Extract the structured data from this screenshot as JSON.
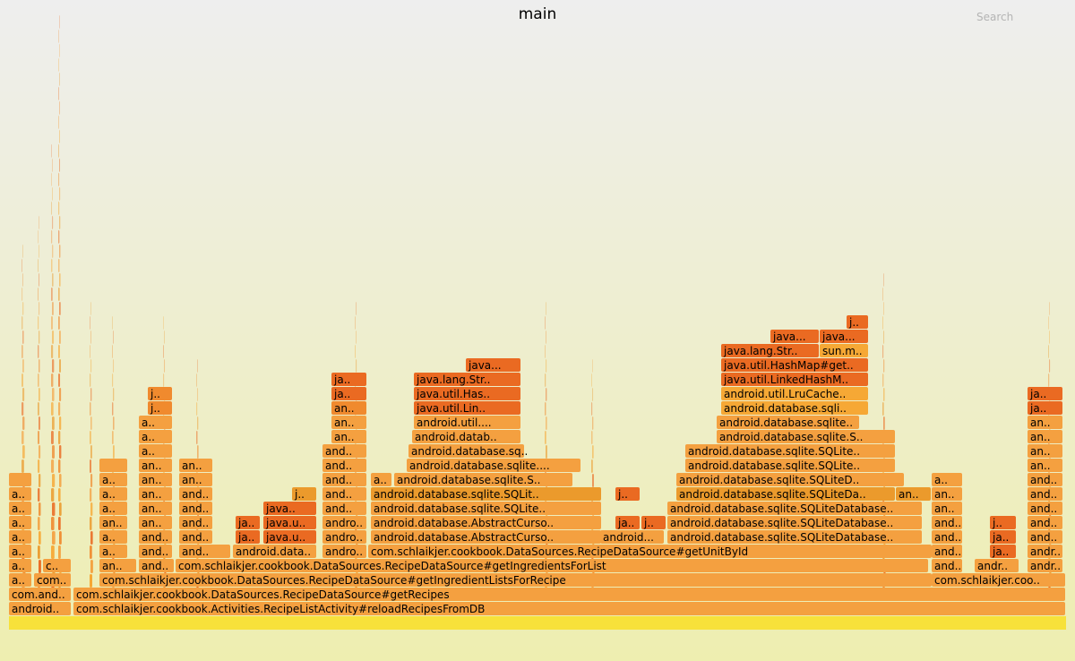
{
  "header": {
    "title": "main",
    "search_label": "Search"
  },
  "chart_data": {
    "type": "flame",
    "unit": "samples",
    "total": 1180,
    "root_color": "#f7e13a",
    "frame_colors": [
      "#f4a040",
      "#f08a2e",
      "#ea6a22",
      "#eb9a2c",
      "#f6a835"
    ],
    "frames": [
      {
        "d": 1,
        "s": 0,
        "w": 70,
        "label": "android..",
        "c": 0
      },
      {
        "d": 1,
        "s": 72,
        "w": 1108,
        "label": "com.schlaikjer.cookbook.Activities.RecipeListActivity#reloadRecipesFromDB",
        "c": 0
      },
      {
        "d": 2,
        "s": 0,
        "w": 70,
        "label": "com.and..",
        "c": 0
      },
      {
        "d": 2,
        "s": 72,
        "w": 1108,
        "label": "com.schlaikjer.cookbook.DataSources.RecipeDataSource#getRecipes",
        "c": 0
      },
      {
        "d": 3,
        "s": 0,
        "w": 26,
        "label": "a..",
        "c": 0
      },
      {
        "d": 3,
        "s": 28,
        "w": 42,
        "label": "com..",
        "c": 0
      },
      {
        "d": 3,
        "s": 101,
        "w": 930,
        "label": "com.schlaikjer.cookbook.DataSources.RecipeDataSource#getIngredientListsForRecipe",
        "c": 0
      },
      {
        "d": 3,
        "s": 1030,
        "w": 150,
        "label": "com.schlaikjer.coo..",
        "c": 0
      },
      {
        "d": 4,
        "s": 0,
        "w": 26,
        "label": "a..",
        "c": 0
      },
      {
        "d": 4,
        "s": 38,
        "w": 32,
        "label": "c..",
        "c": 0
      },
      {
        "d": 4,
        "s": 101,
        "w": 42,
        "label": "an..",
        "c": 0
      },
      {
        "d": 4,
        "s": 145,
        "w": 40,
        "label": "and..",
        "c": 0
      },
      {
        "d": 4,
        "s": 186,
        "w": 841,
        "label": "com.schlaikjer.cookbook.DataSources.RecipeDataSource#getIngredientsForList",
        "c": 0
      },
      {
        "d": 4,
        "s": 1030,
        "w": 35,
        "label": "and..",
        "c": 0
      },
      {
        "d": 4,
        "s": 1078,
        "w": 50,
        "label": "andr..",
        "c": 0
      },
      {
        "d": 4,
        "s": 1137,
        "w": 40,
        "label": "andr..",
        "c": 0
      },
      {
        "d": 5,
        "s": 0,
        "w": 26,
        "label": "a..",
        "c": 0
      },
      {
        "d": 5,
        "s": 101,
        "w": 32,
        "label": "a..",
        "c": 0
      },
      {
        "d": 5,
        "s": 145,
        "w": 38,
        "label": "and..",
        "c": 0
      },
      {
        "d": 5,
        "s": 190,
        "w": 58,
        "label": "and..",
        "c": 0
      },
      {
        "d": 5,
        "s": 250,
        "w": 94,
        "label": "android.data..",
        "c": 0
      },
      {
        "d": 5,
        "s": 350,
        "w": 50,
        "label": "andro..",
        "c": 0
      },
      {
        "d": 5,
        "s": 401,
        "w": 630,
        "label": "com.schlaikjer.cookbook.DataSources.RecipeDataSource#getUnitById",
        "c": 0
      },
      {
        "d": 5,
        "s": 1030,
        "w": 35,
        "label": "and..",
        "c": 0
      },
      {
        "d": 5,
        "s": 1095,
        "w": 30,
        "label": "ja..",
        "c": 2
      },
      {
        "d": 5,
        "s": 1137,
        "w": 40,
        "label": "andr..",
        "c": 0
      },
      {
        "d": 6,
        "s": 0,
        "w": 26,
        "label": "a..",
        "c": 0
      },
      {
        "d": 6,
        "s": 101,
        "w": 32,
        "label": "a..",
        "c": 0
      },
      {
        "d": 6,
        "s": 145,
        "w": 38,
        "label": "and..",
        "c": 0
      },
      {
        "d": 6,
        "s": 190,
        "w": 38,
        "label": "and..",
        "c": 0
      },
      {
        "d": 6,
        "s": 253,
        "w": 28,
        "label": "ja..",
        "c": 2
      },
      {
        "d": 6,
        "s": 284,
        "w": 60,
        "label": "java.u..",
        "c": 2
      },
      {
        "d": 6,
        "s": 350,
        "w": 50,
        "label": "andro..",
        "c": 0
      },
      {
        "d": 6,
        "s": 404,
        "w": 258,
        "label": "android.database.AbstractCurso..",
        "c": 0
      },
      {
        "d": 6,
        "s": 660,
        "w": 72,
        "label": "android...",
        "c": 0
      },
      {
        "d": 6,
        "s": 735,
        "w": 285,
        "label": "android.database.sqlite.SQLiteDatabase..",
        "c": 0
      },
      {
        "d": 6,
        "s": 1030,
        "w": 35,
        "label": "and..",
        "c": 0
      },
      {
        "d": 6,
        "s": 1095,
        "w": 30,
        "label": "ja..",
        "c": 2
      },
      {
        "d": 6,
        "s": 1137,
        "w": 40,
        "label": "and..",
        "c": 0
      },
      {
        "d": 7,
        "s": 0,
        "w": 26,
        "label": "a..",
        "c": 0
      },
      {
        "d": 7,
        "s": 101,
        "w": 32,
        "label": "an..",
        "c": 0
      },
      {
        "d": 7,
        "s": 145,
        "w": 38,
        "label": "an..",
        "c": 0
      },
      {
        "d": 7,
        "s": 190,
        "w": 38,
        "label": "and..",
        "c": 0
      },
      {
        "d": 7,
        "s": 253,
        "w": 28,
        "label": "ja..",
        "c": 2
      },
      {
        "d": 7,
        "s": 284,
        "w": 60,
        "label": "java.u..",
        "c": 2
      },
      {
        "d": 7,
        "s": 350,
        "w": 50,
        "label": "andro..",
        "c": 0
      },
      {
        "d": 7,
        "s": 404,
        "w": 258,
        "label": "android.database.AbstractCurso..",
        "c": 0
      },
      {
        "d": 7,
        "s": 677,
        "w": 28,
        "label": "ja..",
        "c": 2
      },
      {
        "d": 7,
        "s": 706,
        "w": 28,
        "label": "j..",
        "c": 2
      },
      {
        "d": 7,
        "s": 735,
        "w": 285,
        "label": "android.database.sqlite.SQLiteDatabase..",
        "c": 0
      },
      {
        "d": 7,
        "s": 1030,
        "w": 35,
        "label": "and..",
        "c": 0
      },
      {
        "d": 7,
        "s": 1095,
        "w": 30,
        "label": "j..",
        "c": 2
      },
      {
        "d": 7,
        "s": 1137,
        "w": 40,
        "label": "and..",
        "c": 0
      },
      {
        "d": 8,
        "s": 0,
        "w": 26,
        "label": "a..",
        "c": 0
      },
      {
        "d": 8,
        "s": 101,
        "w": 32,
        "label": "a..",
        "c": 0
      },
      {
        "d": 8,
        "s": 145,
        "w": 38,
        "label": "an..",
        "c": 0
      },
      {
        "d": 8,
        "s": 190,
        "w": 38,
        "label": "and..",
        "c": 0
      },
      {
        "d": 8,
        "s": 284,
        "w": 60,
        "label": "java..",
        "c": 2
      },
      {
        "d": 8,
        "s": 350,
        "w": 50,
        "label": "and..",
        "c": 0
      },
      {
        "d": 8,
        "s": 404,
        "w": 258,
        "label": "android.database.sqlite.SQLite..",
        "c": 0
      },
      {
        "d": 8,
        "s": 735,
        "w": 285,
        "label": "android.database.sqlite.SQLiteDatabase..",
        "c": 0
      },
      {
        "d": 8,
        "s": 1030,
        "w": 35,
        "label": "an..",
        "c": 0
      },
      {
        "d": 8,
        "s": 1137,
        "w": 40,
        "label": "and..",
        "c": 0
      },
      {
        "d": 9,
        "s": 0,
        "w": 26,
        "label": "a..",
        "c": 0
      },
      {
        "d": 9,
        "s": 101,
        "w": 32,
        "label": "a..",
        "c": 0
      },
      {
        "d": 9,
        "s": 145,
        "w": 38,
        "label": "an..",
        "c": 0
      },
      {
        "d": 9,
        "s": 190,
        "w": 38,
        "label": "and..",
        "c": 0
      },
      {
        "d": 9,
        "s": 316,
        "w": 28,
        "label": "j..",
        "c": 3
      },
      {
        "d": 9,
        "s": 350,
        "w": 50,
        "label": "and..",
        "c": 0
      },
      {
        "d": 9,
        "s": 404,
        "w": 258,
        "label": "android.database.sqlite.SQLit..",
        "c": 3
      },
      {
        "d": 9,
        "s": 677,
        "w": 28,
        "label": "j..",
        "c": 2
      },
      {
        "d": 9,
        "s": 745,
        "w": 245,
        "label": "android.database.sqlite.SQLiteDa..",
        "c": 3
      },
      {
        "d": 9,
        "s": 990,
        "w": 40,
        "label": "an..",
        "c": 3
      },
      {
        "d": 9,
        "s": 1030,
        "w": 35,
        "label": "an..",
        "c": 0
      },
      {
        "d": 9,
        "s": 1137,
        "w": 40,
        "label": "and..",
        "c": 0
      },
      {
        "d": 10,
        "s": 0,
        "w": 26,
        "label": "",
        "c": 0
      },
      {
        "d": 10,
        "s": 101,
        "w": 32,
        "label": "a..",
        "c": 0
      },
      {
        "d": 10,
        "s": 145,
        "w": 38,
        "label": "an..",
        "c": 0
      },
      {
        "d": 10,
        "s": 190,
        "w": 38,
        "label": "an..",
        "c": 0
      },
      {
        "d": 10,
        "s": 350,
        "w": 50,
        "label": "and..",
        "c": 0
      },
      {
        "d": 10,
        "s": 404,
        "w": 24,
        "label": "a..",
        "c": 0
      },
      {
        "d": 10,
        "s": 430,
        "w": 200,
        "label": "android.database.sqlite.S..",
        "c": 0
      },
      {
        "d": 10,
        "s": 745,
        "w": 255,
        "label": "android.database.sqlite.SQLiteD..",
        "c": 0
      },
      {
        "d": 10,
        "s": 1030,
        "w": 35,
        "label": "a..",
        "c": 0
      },
      {
        "d": 10,
        "s": 1137,
        "w": 40,
        "label": "and..",
        "c": 0
      },
      {
        "d": 11,
        "s": 101,
        "w": 32,
        "label": "",
        "c": 0
      },
      {
        "d": 11,
        "s": 145,
        "w": 38,
        "label": "an..",
        "c": 0
      },
      {
        "d": 11,
        "s": 190,
        "w": 38,
        "label": "an..",
        "c": 0
      },
      {
        "d": 11,
        "s": 350,
        "w": 50,
        "label": "and..",
        "c": 0
      },
      {
        "d": 11,
        "s": 444,
        "w": 195,
        "label": "android.database.sqlite....",
        "c": 0
      },
      {
        "d": 11,
        "s": 755,
        "w": 235,
        "label": "android.database.sqlite.SQLite..",
        "c": 0
      },
      {
        "d": 11,
        "s": 1137,
        "w": 40,
        "label": "an..",
        "c": 0
      },
      {
        "d": 12,
        "s": 145,
        "w": 38,
        "label": "a..",
        "c": 0
      },
      {
        "d": 12,
        "s": 350,
        "w": 50,
        "label": "and..",
        "c": 0
      },
      {
        "d": 12,
        "s": 446,
        "w": 130,
        "label": "android.database.sq..",
        "c": 0
      },
      {
        "d": 12,
        "s": 755,
        "w": 235,
        "label": "android.database.sqlite.SQLite..",
        "c": 0
      },
      {
        "d": 12,
        "s": 1137,
        "w": 40,
        "label": "an..",
        "c": 0
      },
      {
        "d": 13,
        "s": 145,
        "w": 38,
        "label": "a..",
        "c": 0
      },
      {
        "d": 13,
        "s": 360,
        "w": 40,
        "label": "an..",
        "c": 0
      },
      {
        "d": 13,
        "s": 450,
        "w": 122,
        "label": "android.datab..",
        "c": 0
      },
      {
        "d": 13,
        "s": 790,
        "w": 200,
        "label": "android.database.sqlite.S..",
        "c": 0
      },
      {
        "d": 13,
        "s": 1137,
        "w": 40,
        "label": "an..",
        "c": 0
      },
      {
        "d": 14,
        "s": 145,
        "w": 38,
        "label": "a..",
        "c": 0
      },
      {
        "d": 14,
        "s": 360,
        "w": 40,
        "label": "an..",
        "c": 0
      },
      {
        "d": 14,
        "s": 452,
        "w": 120,
        "label": "android.util....",
        "c": 0
      },
      {
        "d": 14,
        "s": 790,
        "w": 160,
        "label": "android.database.sqlite..",
        "c": 0
      },
      {
        "d": 14,
        "s": 1137,
        "w": 40,
        "label": "an..",
        "c": 0
      },
      {
        "d": 15,
        "s": 155,
        "w": 28,
        "label": "j..",
        "c": 1
      },
      {
        "d": 15,
        "s": 360,
        "w": 40,
        "label": "an..",
        "c": 1
      },
      {
        "d": 15,
        "s": 452,
        "w": 120,
        "label": "java.util.Lin..",
        "c": 2
      },
      {
        "d": 15,
        "s": 795,
        "w": 165,
        "label": "android.database.sqli..",
        "c": 4
      },
      {
        "d": 15,
        "s": 1137,
        "w": 40,
        "label": "ja..",
        "c": 2
      },
      {
        "d": 16,
        "s": 155,
        "w": 28,
        "label": "j..",
        "c": 1
      },
      {
        "d": 16,
        "s": 360,
        "w": 40,
        "label": "ja..",
        "c": 2
      },
      {
        "d": 16,
        "s": 452,
        "w": 120,
        "label": "java.util.Has..",
        "c": 2
      },
      {
        "d": 16,
        "s": 795,
        "w": 165,
        "label": "android.util.LruCache..",
        "c": 4
      },
      {
        "d": 16,
        "s": 1137,
        "w": 40,
        "label": "ja..",
        "c": 2
      },
      {
        "d": 17,
        "s": 360,
        "w": 40,
        "label": "ja..",
        "c": 2
      },
      {
        "d": 17,
        "s": 452,
        "w": 120,
        "label": "java.lang.Str..",
        "c": 2
      },
      {
        "d": 17,
        "s": 795,
        "w": 165,
        "label": "java.util.LinkedHashM..",
        "c": 2
      },
      {
        "d": 18,
        "s": 510,
        "w": 62,
        "label": "java...",
        "c": 2
      },
      {
        "d": 18,
        "s": 795,
        "w": 165,
        "label": "java.util.HashMap#get..",
        "c": 2
      },
      {
        "d": 19,
        "s": 795,
        "w": 110,
        "label": "java.lang.Str..",
        "c": 2
      },
      {
        "d": 19,
        "s": 905,
        "w": 55,
        "label": "sun.m..",
        "c": 4
      },
      {
        "d": 20,
        "s": 850,
        "w": 55,
        "label": "java...",
        "c": 2
      },
      {
        "d": 20,
        "s": 905,
        "w": 55,
        "label": "java...",
        "c": 2
      },
      {
        "d": 21,
        "s": 935,
        "w": 25,
        "label": "j..",
        "c": 2
      }
    ],
    "spikes": [
      {
        "s": 14,
        "w": 4,
        "h": 24
      },
      {
        "s": 32,
        "w": 3,
        "h": 26
      },
      {
        "s": 47,
        "w": 4,
        "h": 31
      },
      {
        "s": 55,
        "w": 3,
        "h": 40
      },
      {
        "s": 90,
        "w": 3,
        "h": 20
      },
      {
        "s": 115,
        "w": 3,
        "h": 19
      },
      {
        "s": 172,
        "w": 3,
        "h": 19
      },
      {
        "s": 209,
        "w": 3,
        "h": 16
      },
      {
        "s": 386,
        "w": 3,
        "h": 20
      },
      {
        "s": 598,
        "w": 3,
        "h": 20
      },
      {
        "s": 650,
        "w": 3,
        "h": 16
      },
      {
        "s": 975,
        "w": 3,
        "h": 22
      },
      {
        "s": 1160,
        "w": 3,
        "h": 20
      }
    ]
  }
}
